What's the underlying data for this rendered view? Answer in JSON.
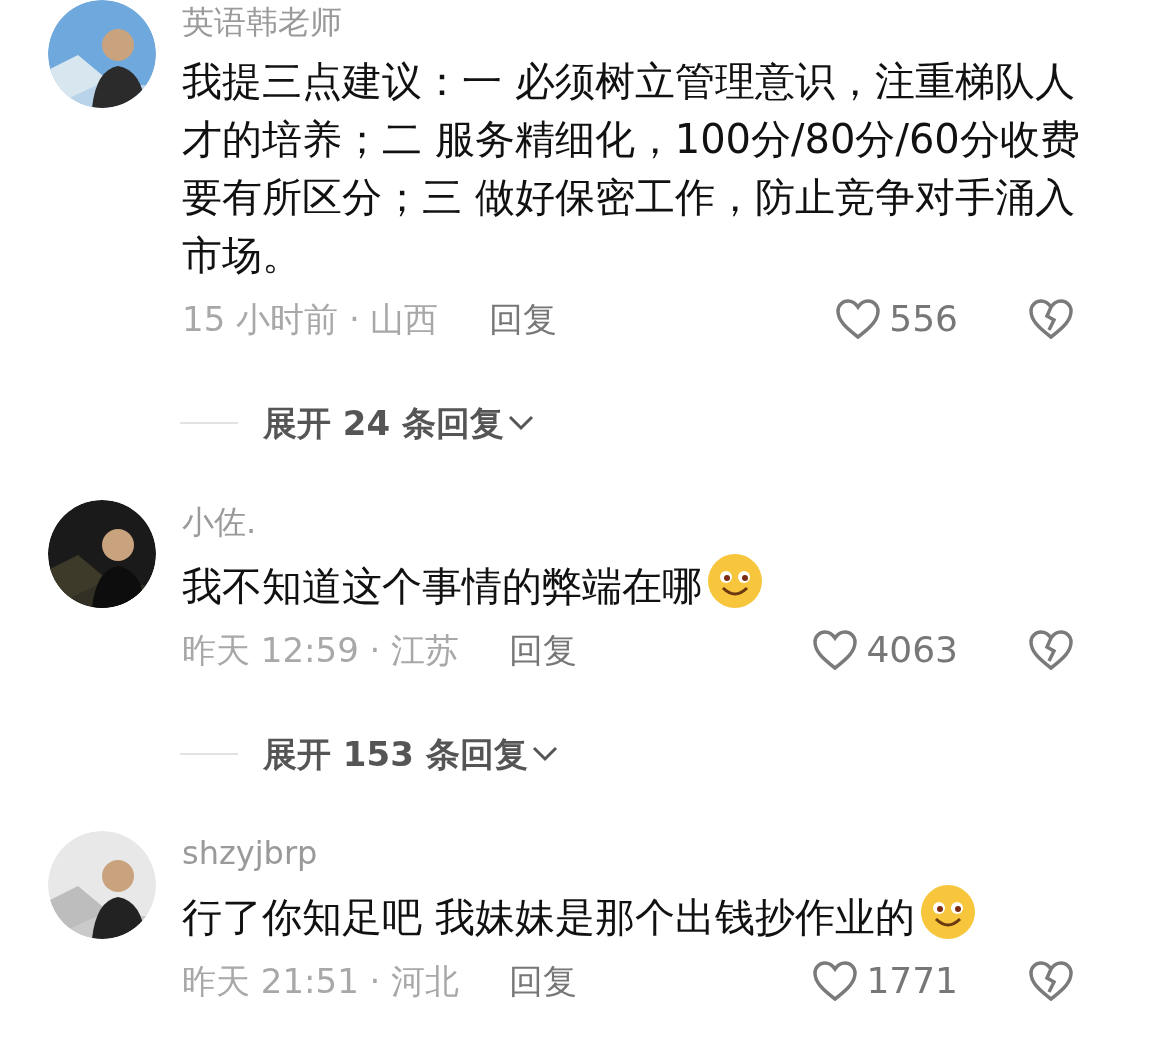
{
  "comments": [
    {
      "name": "英语韩老师",
      "text": "我提三点建议：一 必须树立管理意识，注重梯队人才的培养；二 服务精细化，100分/80分/60分收费要有所区分；三 做好保密工作，防止竞争对手涌入市场。",
      "emoji": false,
      "meta": "15 小时前 · 山西",
      "reply": "回复",
      "likes": "556",
      "expand": "展开 24 条回复"
    },
    {
      "name": "小佐.",
      "text": "我不知道这个事情的弊端在哪",
      "emoji": true,
      "meta": "昨天 12:59 · 江苏",
      "reply": "回复",
      "likes": "4063",
      "expand": "展开 153 条回复"
    },
    {
      "name": "shzyjbrp",
      "text": "行了你知足吧 我妹妹是那个出钱抄作业的",
      "emoji": true,
      "meta": "昨天 21:51 · 河北",
      "reply": "回复",
      "likes": "1771"
    }
  ]
}
